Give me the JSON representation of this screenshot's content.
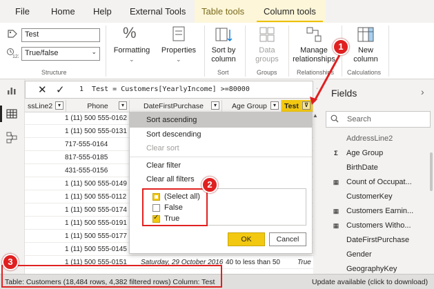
{
  "tabs": {
    "file": "File",
    "home": "Home",
    "help": "Help",
    "external_tools": "External Tools",
    "table_tools": "Table tools",
    "column_tools": "Column tools"
  },
  "ribbon": {
    "name_value": "Test",
    "datatype_value": "True/false",
    "formatting_label": "Formatting",
    "properties_label": "Properties",
    "sort_by_label": "Sort by",
    "sort_by_label2": "column",
    "data_groups_label": "Data",
    "data_groups_label2": "groups",
    "manage_rel_label": "Manage",
    "manage_rel_label2": "relationships",
    "new_column_label": "New",
    "new_column_label2": "column",
    "group_structure": "Structure",
    "group_sort": "Sort",
    "group_groups": "Groups",
    "group_relationships": "Relationships",
    "group_calculations": "Calculations"
  },
  "formula": {
    "text": "1  Test = Customers[YearlyIncome] >=80000"
  },
  "table": {
    "headers": [
      "ssLine2",
      "Phone",
      "DateFirstPurchase",
      "Age Group",
      "Test"
    ],
    "rows": [
      {
        "phone": "1 (11) 500 555-0162"
      },
      {
        "phone": "1 (11) 500 555-0131"
      },
      {
        "phone": "717-555-0164"
      },
      {
        "phone": "817-555-0185"
      },
      {
        "phone": "431-555-0156"
      },
      {
        "phone": "1 (11) 500 555-0149"
      },
      {
        "phone": "1 (11) 500 555-0112"
      },
      {
        "phone": "1 (11) 500 555-0174"
      },
      {
        "phone": "1 (11) 500 555-0191"
      },
      {
        "phone": "1 (11) 500 555-0177"
      },
      {
        "phone": "1 (11) 500 555-0145"
      },
      {
        "phone": "1 (11) 500 555-0151",
        "date": "Saturday, 29 October 2016",
        "age": "40 to less than 50",
        "test": "True"
      }
    ]
  },
  "dropdown": {
    "sort_asc": "Sort ascending",
    "sort_desc": "Sort descending",
    "clear_sort": "Clear sort",
    "clear_filter": "Clear filter",
    "clear_all": "Clear all filters",
    "opt_all": "(Select all)",
    "opt_false": "False",
    "opt_true": "True",
    "ok": "OK",
    "cancel": "Cancel"
  },
  "fields": {
    "title": "Fields",
    "search_placeholder": "Search",
    "items": [
      "AddressLine2",
      "Age Group",
      "BirthDate",
      "Count of Occupat...",
      "CustomerKey",
      "Customers Earnin...",
      "Customers Witho...",
      "DateFirstPurchase",
      "Gender",
      "GeographyKey"
    ]
  },
  "status": {
    "left": "Table: Customers (18,484 rows, 4,382 filtered rows) Column: Test",
    "right": "Update available (click to download)"
  },
  "callouts": [
    "1",
    "2",
    "3"
  ],
  "colors": {
    "accent": "#f2c811",
    "callout": "#e02020"
  }
}
